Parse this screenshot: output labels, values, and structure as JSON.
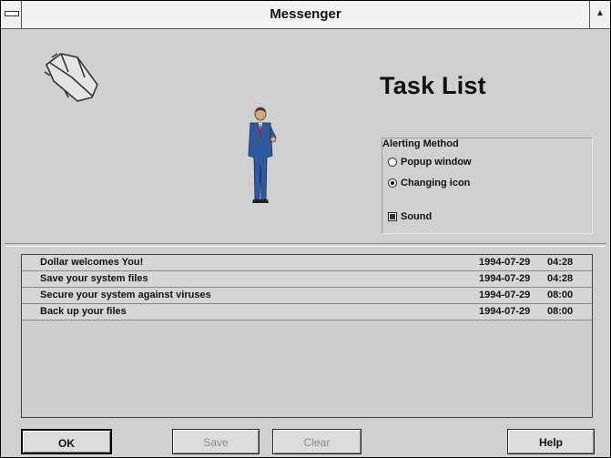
{
  "window": {
    "title": "Messenger"
  },
  "main": {
    "heading": "Task List"
  },
  "alerting": {
    "title": "Alerting Method",
    "options": [
      {
        "label": "Popup window",
        "selected": false
      },
      {
        "label": "Changing icon",
        "selected": true
      }
    ],
    "sound": {
      "label": "Sound",
      "checked": true
    }
  },
  "tasks": [
    {
      "text": "Dollar welcomes You!",
      "date": "1994-07-29",
      "time": "04:28"
    },
    {
      "text": "Save your system files",
      "date": "1994-07-29",
      "time": "04:28"
    },
    {
      "text": "Secure your system against viruses",
      "date": "1994-07-29",
      "time": "08:00"
    },
    {
      "text": "Back up your files",
      "date": "1994-07-29",
      "time": "08:00"
    }
  ],
  "buttons": {
    "ok": "OK",
    "save": "Save",
    "clear": "Clear",
    "help": "Help"
  }
}
